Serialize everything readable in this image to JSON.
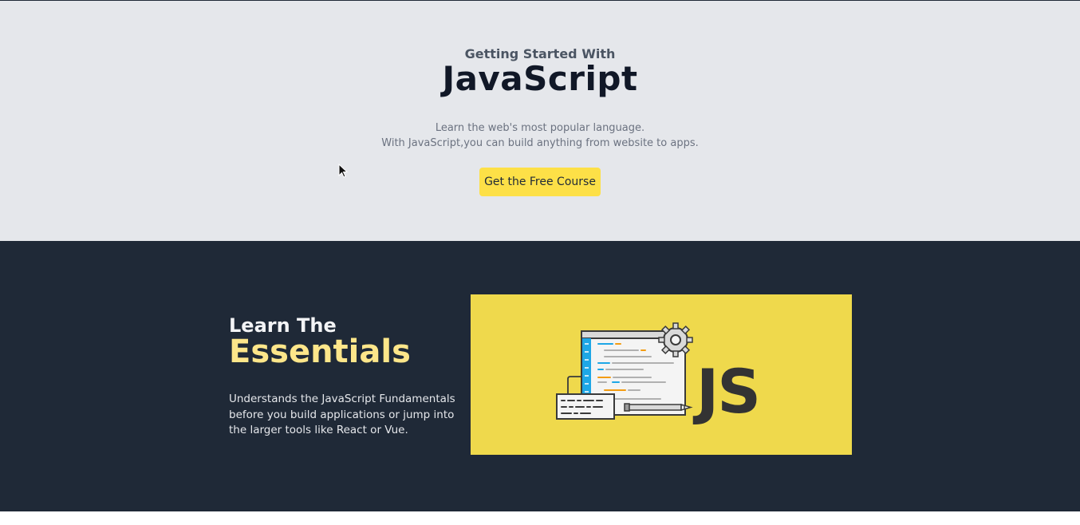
{
  "hero": {
    "subtitle": "Getting Started With",
    "title": "JavaScript",
    "description_line1": "Learn the web's most popular language.",
    "description_line2": "With JavaScript,you can build anything from website to apps.",
    "cta_label": "Get the Free Course",
    "background": "#e5e7eb",
    "cta_color": "#fde047"
  },
  "essentials": {
    "kicker": "Learn The",
    "title": "Essentials",
    "description": "Understands the JavaScript Fundamentals before you build applications or jump into the larger tools like React or Vue.",
    "background": "#1f2937",
    "accent": "#fde68a",
    "image": {
      "logo_text": "JS",
      "icon": "code-editor-illustration",
      "background": "#efd94c"
    }
  }
}
